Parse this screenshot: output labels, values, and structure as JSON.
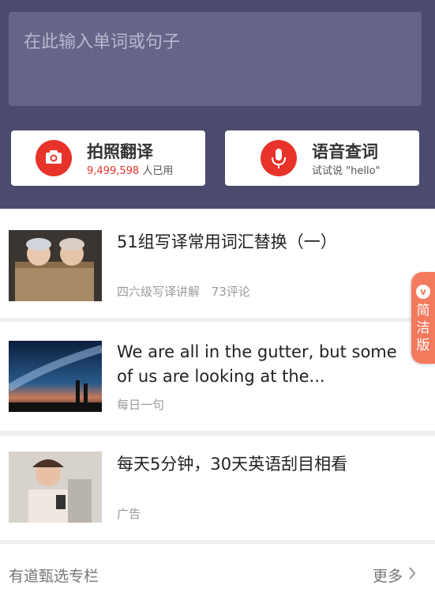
{
  "search": {
    "placeholder": "在此输入单词或句子"
  },
  "actions": {
    "photo": {
      "title": "拍照翻译",
      "count": "9,499,598",
      "count_suffix": "人已用",
      "icon": "camera-icon"
    },
    "voice": {
      "title": "语音查词",
      "subtitle": "试试说 \"hello\"",
      "icon": "microphone-icon"
    }
  },
  "feed": [
    {
      "title": "51组写译常用词汇替换（一）",
      "tag": "四六级写译讲解",
      "comments": "73评论"
    },
    {
      "title": "We are all in the gutter, but some of us are looking at the...",
      "tag": "每日一句"
    },
    {
      "title": "每天5分钟，30天英语刮目相看",
      "tag": "广告"
    }
  ],
  "float_tab": {
    "badge": "v",
    "label": "简洁版"
  },
  "footer": {
    "title": "有道甄选专栏",
    "more": "更多"
  },
  "colors": {
    "header_bg": "#4b4b6e",
    "accent": "#e8332b",
    "float_tab": "#f47a5e"
  }
}
